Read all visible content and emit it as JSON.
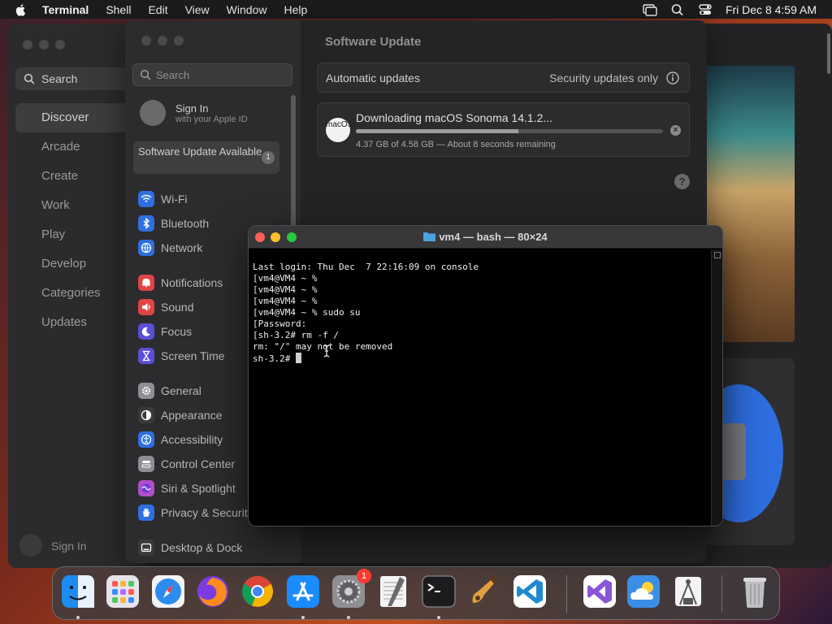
{
  "menubar": {
    "app": "Terminal",
    "items": [
      "Shell",
      "Edit",
      "View",
      "Window",
      "Help"
    ],
    "clock": "Fri Dec 8  4:59 AM"
  },
  "appstore": {
    "search_placeholder": "Search",
    "nav": [
      "Discover",
      "Arcade",
      "Create",
      "Work",
      "Play",
      "Develop",
      "Categories",
      "Updates"
    ],
    "selected": "Discover",
    "signin": "Sign In"
  },
  "settings": {
    "search_placeholder": "Search",
    "signin_title": "Sign In",
    "signin_sub": "with your Apple ID",
    "update_label": "Software Update Available",
    "update_count": "1",
    "groups": [
      [
        {
          "label": "Wi-Fi",
          "icon": "wifi-icon",
          "color": "#2f6fe0"
        },
        {
          "label": "Bluetooth",
          "icon": "bluetooth-icon",
          "color": "#2f6fe0"
        },
        {
          "label": "Network",
          "icon": "globe-icon",
          "color": "#2f6fe0"
        }
      ],
      [
        {
          "label": "Notifications",
          "icon": "bell-icon",
          "color": "#e04545"
        },
        {
          "label": "Sound",
          "icon": "speaker-icon",
          "color": "#e04545"
        },
        {
          "label": "Focus",
          "icon": "moon-icon",
          "color": "#5b4fd6"
        },
        {
          "label": "Screen Time",
          "icon": "hourglass-icon",
          "color": "#5b4fd6"
        }
      ],
      [
        {
          "label": "General",
          "icon": "gear-icon",
          "color": "#8e8e93"
        },
        {
          "label": "Appearance",
          "icon": "appearance-icon",
          "color": "#3a3a3c"
        },
        {
          "label": "Accessibility",
          "icon": "accessibility-icon",
          "color": "#2f6fe0"
        },
        {
          "label": "Control Center",
          "icon": "control-center-icon",
          "color": "#8e8e93"
        },
        {
          "label": "Siri & Spotlight",
          "icon": "siri-icon",
          "color": "#b04fc9"
        },
        {
          "label": "Privacy & Security",
          "icon": "hand-icon",
          "color": "#2f6fe0"
        }
      ],
      [
        {
          "label": "Desktop & Dock",
          "icon": "dock-icon",
          "color": "#3a3a3c"
        }
      ]
    ],
    "main": {
      "title": "Software Update",
      "auto_label": "Automatic updates",
      "auto_value": "Security updates only",
      "download_title": "Downloading macOS Sonoma 14.1.2...",
      "download_status": "4.37 GB of 4.58 GB — About 8 seconds remaining",
      "progress": 0.53,
      "os_icon_text": "macOS"
    }
  },
  "terminal": {
    "title": "vm4 — bash — 80×24",
    "lines": [
      "Last login: Thu Dec  7 22:16:09 on console",
      "[vm4@VM4 ~ %",
      "[vm4@VM4 ~ %",
      "[vm4@VM4 ~ %",
      "[vm4@VM4 ~ % sudo su",
      "[Password:",
      "[sh-3.2# rm -f /",
      "rm: \"/\" may not be removed",
      "sh-3.2# "
    ]
  },
  "dock": {
    "apps": [
      {
        "name": "Finder",
        "icon": "finder-icon",
        "color": "#1e8bf0",
        "running": true
      },
      {
        "name": "Launchpad",
        "icon": "launchpad-icon",
        "color": "#d9d9de",
        "running": false
      },
      {
        "name": "Safari",
        "icon": "safari-icon",
        "color": "#2d8cf0",
        "running": false
      },
      {
        "name": "Firefox",
        "icon": "firefox-icon",
        "color": "#ff7139",
        "running": false
      },
      {
        "name": "Chrome",
        "icon": "chrome-icon",
        "color": "#ffffff",
        "running": false
      },
      {
        "name": "App Store",
        "icon": "app-store-icon",
        "color": "#1a8cff",
        "running": true
      },
      {
        "name": "System Settings",
        "icon": "settings-icon",
        "color": "#8e8e93",
        "running": true,
        "badge": "1"
      },
      {
        "name": "TextEdit",
        "icon": "textedit-icon",
        "color": "#f4f4f4",
        "running": false
      },
      {
        "name": "Terminal",
        "icon": "terminal-icon",
        "color": "#1c1c1e",
        "running": true
      },
      {
        "name": "GarageBand",
        "icon": "garageband-icon",
        "color": "#e0a040",
        "running": false
      },
      {
        "name": "Visual Studio Code",
        "icon": "vscode-icon",
        "color": "#ffffff",
        "running": false
      },
      {
        "name": "Visual Studio",
        "icon": "visual-studio-icon",
        "color": "#ffffff",
        "running": false
      },
      {
        "name": "Weather",
        "icon": "weather-icon",
        "color": "#3a8ee6",
        "running": false
      },
      {
        "name": "Scanner",
        "icon": "scanner-icon",
        "color": "#f4f4f4",
        "running": false
      },
      {
        "name": "Trash",
        "icon": "trash-icon",
        "color": "#bfbfc3",
        "running": false
      }
    ]
  }
}
